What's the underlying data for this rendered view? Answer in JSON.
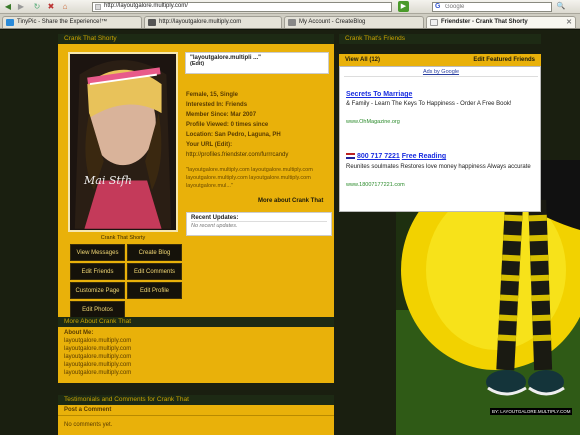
{
  "browser": {
    "url": "http://layoutgalore.multiply.com/",
    "search_placeholder": "Google",
    "tabs": [
      {
        "label": "TinyPic - Share the Experience!™",
        "active": false
      },
      {
        "label": "http://layoutgalore.multiply.com",
        "active": false
      },
      {
        "label": "My Account - CreateBlog",
        "active": false
      },
      {
        "label": "Friendster - Crank That Shorty",
        "active": true
      }
    ]
  },
  "profile": {
    "header_title": "Crank That Shorty",
    "photo_caption": "Crank That Shorty",
    "photo_signature": "Mai Stfh",
    "name_box": "\"layoutgalore.multipli ...\"",
    "name_edit": "(Edit)",
    "info": {
      "line1": "Female, 15, Single",
      "interested_label": "Interested In:",
      "interested_value": "Friends",
      "since_label": "Member Since:",
      "since_value": "Mar 2007",
      "viewed_label": "Profile Viewed:",
      "viewed_value": "0 times since",
      "location_label": "Location:",
      "location_value": "San Pedro, Laguna, PH",
      "url_label": "Your URL",
      "url_edit": "(Edit)",
      "url_value": "http://profiles.friendster.com/furrrcandy"
    },
    "blurb": "\"layoutgalore.multiply.com layoutgalore.multiply.com layoutgalore.multiply.com layoutgalore.multiply.com layoutgalore.mul...\"",
    "more_about": "More about Crank That",
    "recent_title": "Recent Updates:",
    "recent_value": "No recent updates.",
    "buttons": {
      "view_messages": "View Messages",
      "create_blog": "Create Blog",
      "edit_friends": "Edit Friends",
      "edit_comments": "Edit Comments",
      "customize_page": "Customize Page",
      "edit_profile": "Edit Profile",
      "edit_photos": "Edit Photos"
    }
  },
  "about": {
    "header_title": "More About Crank That",
    "label": "About Me:",
    "lines": [
      "layoutgalore.multiply.com",
      "layoutgalore.multiply.com",
      "layoutgalore.multiply.com",
      "layoutgalore.multiply.com",
      "layoutgalore.multiply.com"
    ]
  },
  "comments": {
    "header_title": "Testimonials and Comments for Crank That",
    "post_label": "Post a Comment",
    "empty_text": "No comments yet."
  },
  "friends": {
    "header_title": "Crank That's Friends",
    "view_all": "View All (12)",
    "edit_featured": "Edit Featured Friends"
  },
  "ads": {
    "ads_by": "Ads by Google",
    "ad1": {
      "title": "Secrets To Marriage",
      "desc": "& Family - Learn The Keys To Happiness - Order A Free Book!",
      "url": "www.OhMagazine.org"
    },
    "ad2": {
      "phone": "800 717 7221",
      "title": "Free Reading",
      "desc": "Reunites soulmates Restores love money happiness Always accurate",
      "url": "www.18007177221.com"
    }
  },
  "watermark": "BY: LAYOUTGALORE.MULTIPLY.COM",
  "colors": {
    "panel": "#e9b10a",
    "header_bg": "#1d2a14",
    "header_text": "#c9a400",
    "button_bg": "#15120a"
  }
}
